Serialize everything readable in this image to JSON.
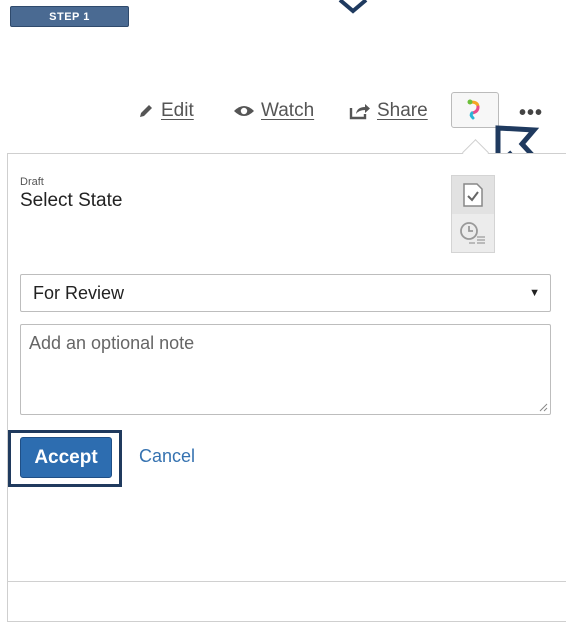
{
  "step_badge": "STEP 1",
  "toolbar": {
    "edit_label": "Edit",
    "watch_label": "Watch",
    "share_label": "Share",
    "more_label": "•••",
    "workflow_icon": "workflow-icon"
  },
  "panel": {
    "status_label": "Draft",
    "title": "Select State",
    "side_tabs": [
      "state-check-icon",
      "history-clock-icon"
    ],
    "state_select": {
      "value": "For Review",
      "caret": "▼"
    },
    "note": {
      "placeholder": "Add an optional note"
    },
    "accept_label": "Accept",
    "cancel_label": "Cancel"
  },
  "colors": {
    "accent": "#2d6db0",
    "highlight_border": "#203a5e",
    "step_badge_bg": "#4a6a92",
    "link": "#3572b0"
  }
}
